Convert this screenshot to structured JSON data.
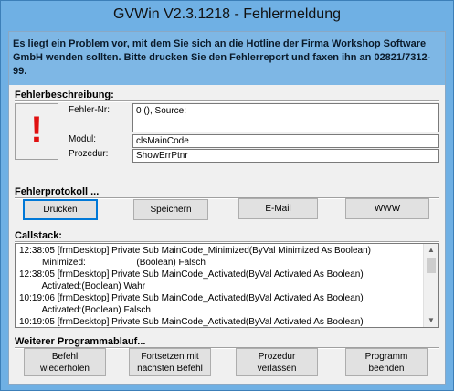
{
  "window": {
    "title": "GVWin  V2.3.1218 - Fehlermeldung"
  },
  "intro": {
    "text": "Es liegt ein Problem vor, mit dem Sie sich an die Hotline der Firma Workshop Software GmbH wenden sollten. Bitte drucken Sie den Fehlerreport und faxen ihn an 02821/7312-99."
  },
  "fehlerbeschreibung": {
    "label": "Fehlerbeschreibung:",
    "icon": "exclamation-icon",
    "icon_glyph": "!",
    "fehler_nr_label": "Fehler-Nr:",
    "fehler_nr_value": "0 (), Source:",
    "modul_label": "Modul:",
    "modul_value": "clsMainCode",
    "prozedur_label": "Prozedur:",
    "prozedur_value": "ShowErrPtnr"
  },
  "fehlerprotokoll": {
    "label": "Fehlerprotokoll ...",
    "buttons": {
      "drucken": "Drucken",
      "speichern": "Speichern",
      "email": "E-Mail",
      "www": "WWW"
    }
  },
  "callstack": {
    "label": "Callstack:",
    "lines": [
      "12:38:05 [frmDesktop] Private Sub MainCode_Minimized(ByVal Minimized As Boolean)",
      "         Minimized:                    (Boolean) Falsch",
      "12:38:05 [frmDesktop] Private Sub MainCode_Activated(ByVal Activated As Boolean)",
      "         Activated:(Boolean) Wahr",
      "10:19:06 [frmDesktop] Private Sub MainCode_Activated(ByVal Activated As Boolean)",
      "         Activated:(Boolean) Falsch",
      "10:19:05 [frmDesktop] Private Sub MainCode_Activated(ByVal Activated As Boolean)"
    ],
    "scroll_up": "▲",
    "scroll_down": "▼"
  },
  "weiterer": {
    "label": "Weiterer Programmablauf...",
    "buttons": {
      "wiederholen": "Befehl\nwiederholen",
      "fortsetzen": "Fortsetzen mit\nnächsten Befehl",
      "verlassen": "Prozedur\nverlassen",
      "beenden": "Programm\nbeenden"
    }
  }
}
